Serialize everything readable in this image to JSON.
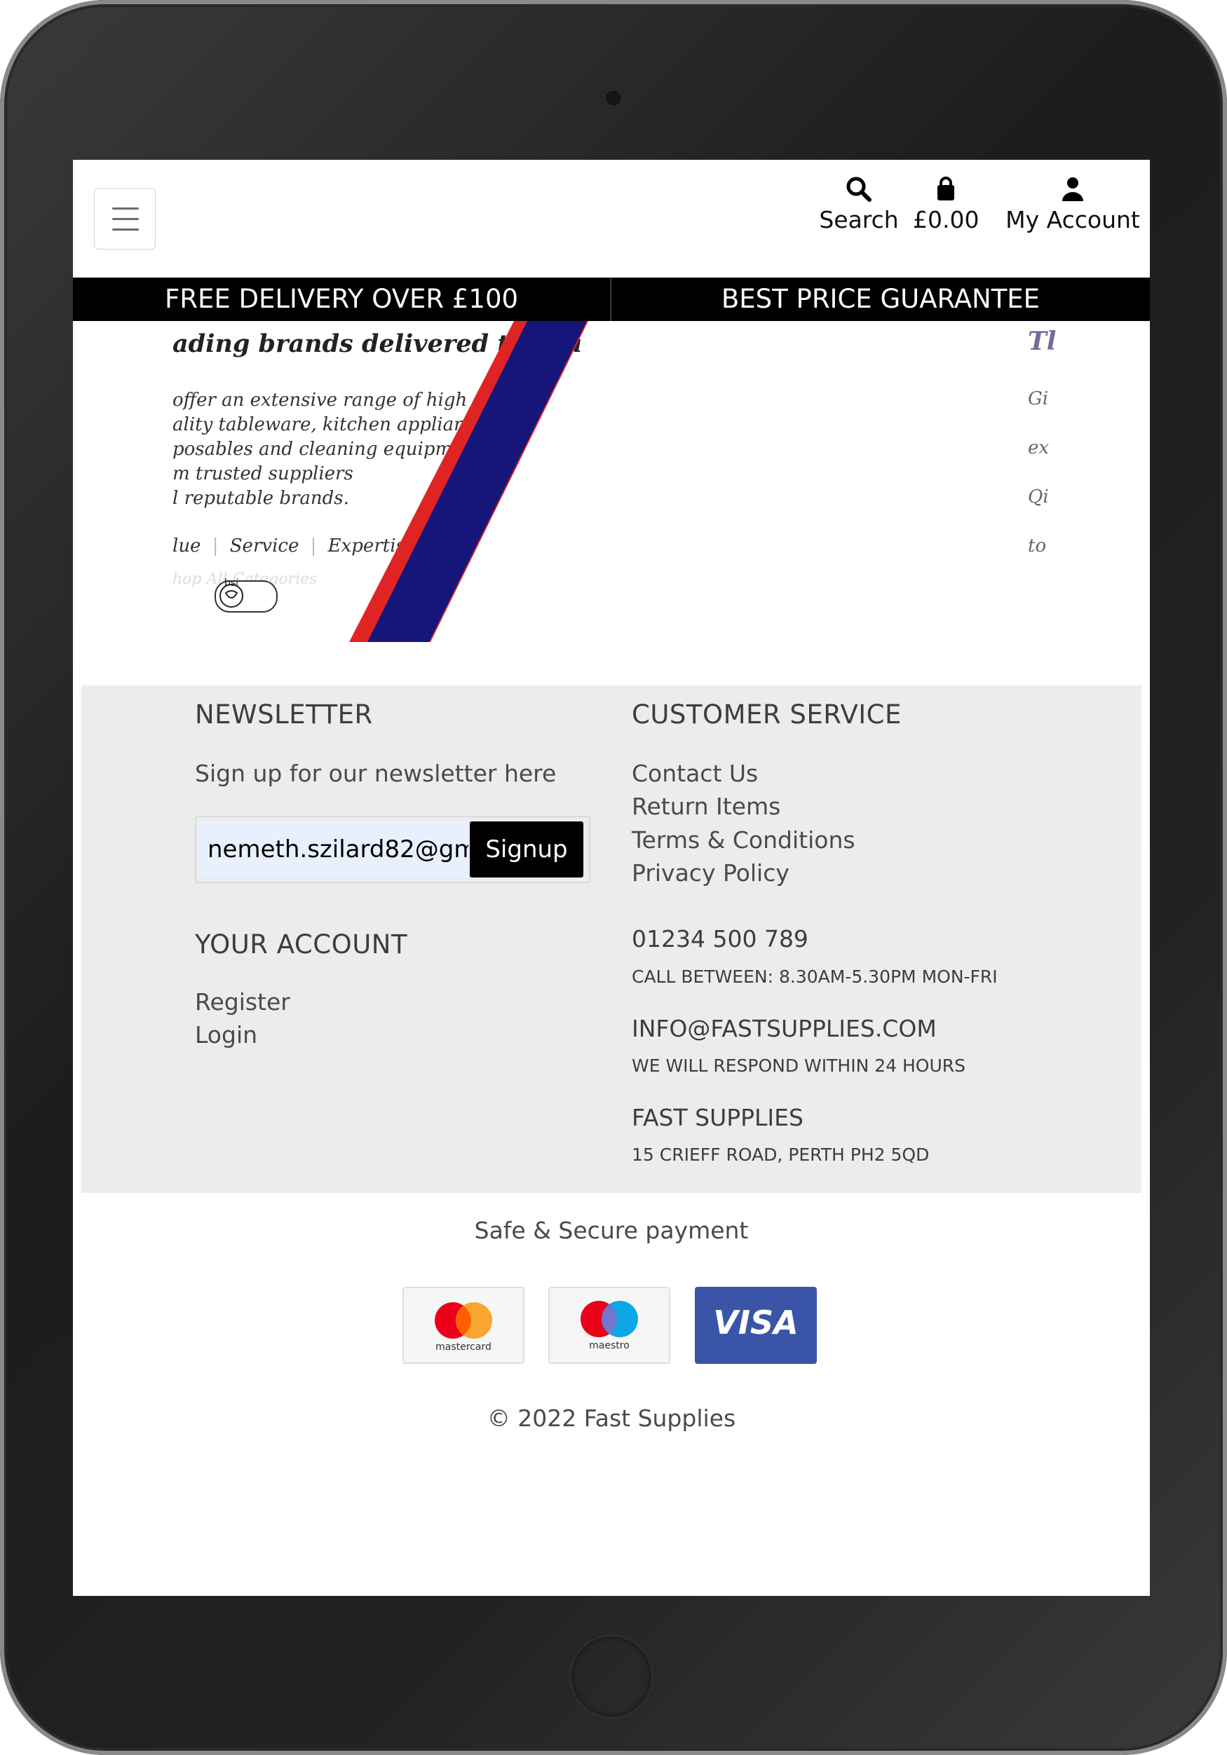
{
  "header": {
    "menu_label": "Menu",
    "search_label": "Search",
    "cart_label": "£0.00",
    "account_label": "My Account"
  },
  "promo": {
    "left": "FREE DELIVERY OVER £100",
    "right": "BEST PRICE GUARANTEE"
  },
  "hero": {
    "heading": "ading brands delivered to you",
    "lines": [
      "offer an extensive range of high",
      "ality tableware, kitchen appliances,",
      "posables and cleaning equipment",
      "m trusted suppliers",
      "l reputable brands."
    ],
    "tagline": [
      "lue",
      "Service",
      "Expertise"
    ],
    "faded_link": "hop All Categories",
    "badge_text": "bsi",
    "right_heading": "Tl",
    "right_lines": [
      "Gi",
      "ex",
      "Qi",
      "to"
    ],
    "colors": {
      "red": "#e02424",
      "navy": "#16167a"
    }
  },
  "footer": {
    "newsletter": {
      "title": "NEWSLETTER",
      "subtitle": "Sign up for our newsletter here",
      "email_value": "nemeth.szilard82@gmail.com",
      "button": "Signup"
    },
    "account": {
      "title": "YOUR ACCOUNT",
      "links": [
        "Register",
        "Login"
      ]
    },
    "service": {
      "title": "CUSTOMER SERVICE",
      "links": [
        "Contact Us",
        "Return Items",
        "Terms & Conditions",
        "Privacy Policy"
      ],
      "phone": "01234 500 789",
      "phone_note": "CALL BETWEEN: 8.30AM-5.30PM MON-FRI",
      "email": "INFO@FASTSUPPLIES.COM",
      "email_note": "WE WILL RESPOND WITHIN 24 HOURS",
      "company": "FAST SUPPLIES",
      "address": "15 CRIEFF ROAD, PERTH PH2 5QD"
    }
  },
  "payment": {
    "title": "Safe & Secure payment",
    "cards": [
      {
        "name": "mastercard",
        "label": "mastercard"
      },
      {
        "name": "maestro",
        "label": "maestro"
      },
      {
        "name": "visa",
        "label": "VISA"
      }
    ],
    "visa_color": "#3a55a8"
  },
  "copyright": "© 2022 Fast Supplies"
}
